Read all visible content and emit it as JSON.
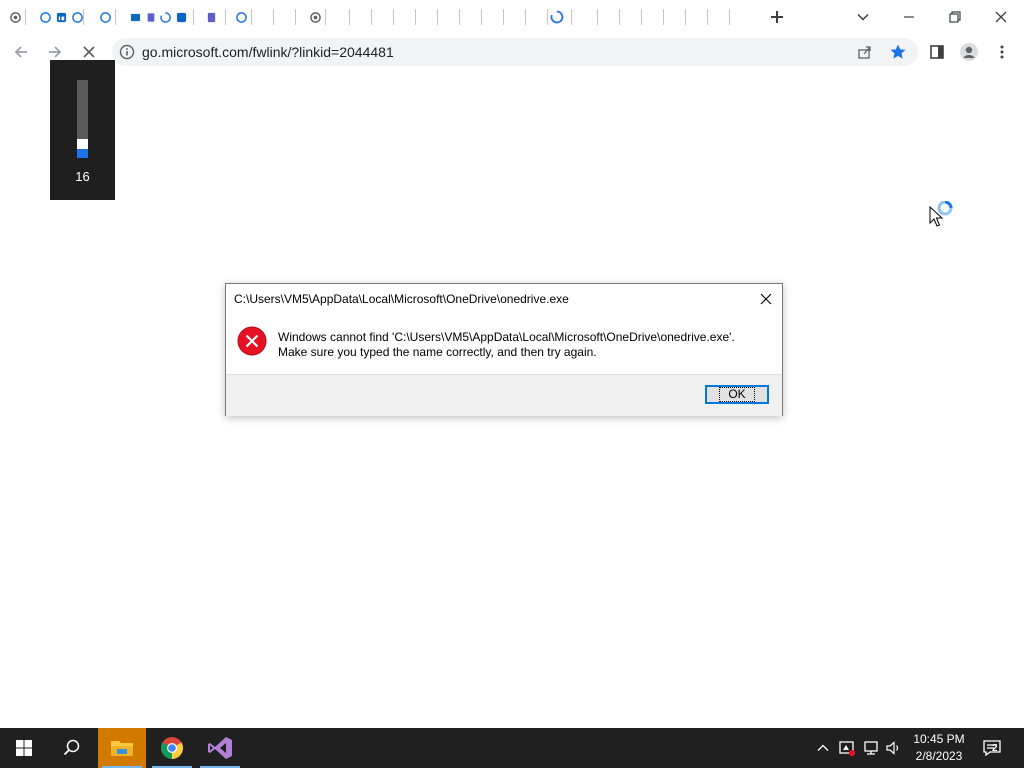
{
  "browser": {
    "tabs_count": 33,
    "address_bar": {
      "url": "go.microsoft.com/fwlink/?linkid=2044481"
    }
  },
  "volume_osd": {
    "level": "16",
    "fraction": 0.16
  },
  "dialog": {
    "title": "C:\\Users\\VM5\\AppData\\Local\\Microsoft\\OneDrive\\onedrive.exe",
    "message_line1": "Windows cannot find 'C:\\Users\\VM5\\AppData\\Local\\Microsoft\\OneDrive\\onedrive.exe'.",
    "message_line2": "Make sure you typed the name correctly, and then try again.",
    "ok_label": "OK"
  },
  "taskbar": {
    "time": "10:45 PM",
    "date": "2/8/2023",
    "notification_count": "2"
  },
  "colors": {
    "accent": "#1a73e8",
    "error_red": "#e81123",
    "taskbar_bg": "#202020",
    "active_task": "#d27a00"
  }
}
